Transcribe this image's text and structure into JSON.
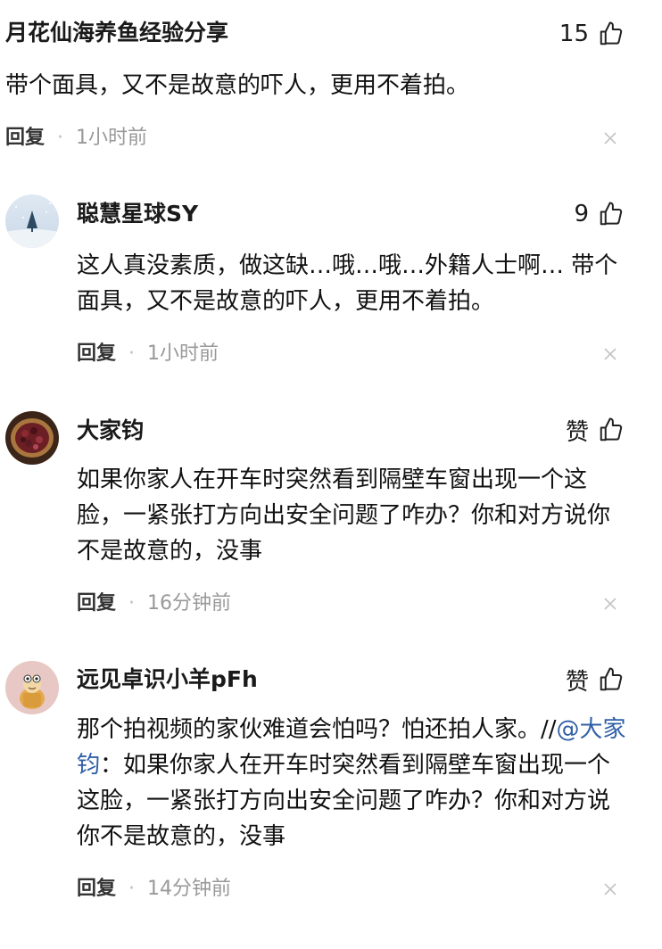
{
  "comments": [
    {
      "name": "月花仙海养鱼经验分享",
      "likes": "15",
      "text": "带个面具，又不是故意的吓人，更用不着拍。",
      "reply": "回复",
      "sep": "·",
      "time": "1小时前",
      "close_icon": "close-icon",
      "like_icon": "thumbs-up-icon"
    },
    {
      "name": "聪慧星球SY",
      "likes": "9",
      "text": "这人真没素质，做这缺…哦…哦…外籍人士啊… 带个面具，又不是故意的吓人，更用不着拍。",
      "reply": "回复",
      "sep": "·",
      "time": "1小时前",
      "avatar_icon": "snowy-tree-avatar"
    },
    {
      "name": "大家钧",
      "likes": "赞",
      "text": "如果你家人在开车时突然看到隔壁车窗出现一个这脸，一紧张打方向出安全问题了咋办？你和对方说你不是故意的，没事",
      "reply": "回复",
      "sep": "·",
      "time": "16分钟前",
      "avatar_icon": "food-platter-avatar"
    },
    {
      "name": "远见卓识小羊pFh",
      "likes": "赞",
      "text_prefix": "那个拍视频的家伙难道会怕吗？怕还拍人家。//",
      "mention": "@大家钧",
      "text_suffix": "：如果你家人在开车时突然看到隔壁车窗出现一个这脸，一紧张打方向出安全问题了咋办？你和对方说你不是故意的，没事",
      "reply": "回复",
      "sep": "·",
      "time": "14分钟前",
      "avatar_icon": "cartoon-cat-avatar"
    }
  ]
}
